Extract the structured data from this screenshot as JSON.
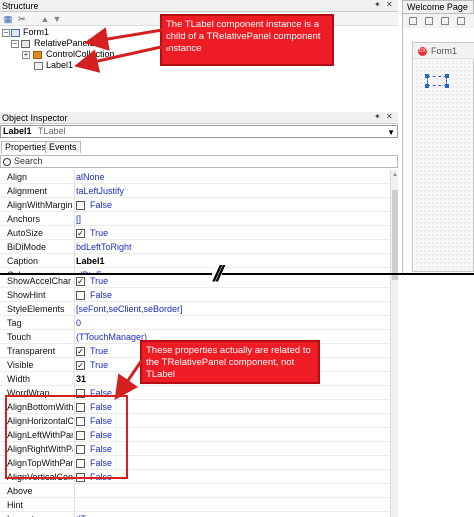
{
  "structure": {
    "title": "Structure",
    "tree": [
      {
        "label": "Form1"
      },
      {
        "label": "RelativePanel1"
      },
      {
        "label": "ControlCollection"
      },
      {
        "label": "Label1"
      }
    ]
  },
  "tabs_right": {
    "welcome": "Welcome Page",
    "form_caption": "Form1"
  },
  "inspector": {
    "title": "Object Inspector",
    "component": "Label1",
    "component_type": "TLabel",
    "tab_properties": "Properties",
    "tab_events": "Events",
    "search_placeholder": "Search",
    "props_top": [
      {
        "name": "Align",
        "value": "alNone"
      },
      {
        "name": "Alignment",
        "value": "taLeftJustify"
      },
      {
        "name": "AlignWithMargins",
        "value": "False",
        "check": true
      },
      {
        "name": "Anchors",
        "value": "[]"
      },
      {
        "name": "AutoSize",
        "value": "True",
        "check": true,
        "checked": true
      },
      {
        "name": "BiDiMode",
        "value": "bdLeftToRight"
      },
      {
        "name": "Caption",
        "value": "Label1",
        "bold": true
      },
      {
        "name": "Color",
        "value": "clBtnFace"
      }
    ],
    "props_bottom": [
      {
        "name": "ShowAccelChar",
        "value": "True",
        "check": true,
        "checked": true
      },
      {
        "name": "ShowHint",
        "value": "False",
        "check": true
      },
      {
        "name": "StyleElements",
        "value": "[seFont,seClient,seBorder]"
      },
      {
        "name": "Tag",
        "value": "0"
      },
      {
        "name": "Touch",
        "value": "(TTouchManager)"
      },
      {
        "name": "Transparent",
        "value": "True",
        "check": true,
        "checked": true
      },
      {
        "name": "Visible",
        "value": "True",
        "check": true,
        "checked": true
      },
      {
        "name": "Width",
        "value": "31",
        "bold": true
      },
      {
        "name": "WordWrap",
        "value": "False",
        "check": true
      },
      {
        "name": "AlignBottomWithPanel",
        "value": "False",
        "check": true
      },
      {
        "name": "AlignHorizontalCenterWithPanel",
        "value": "False",
        "check": true
      },
      {
        "name": "AlignLeftWithPanel",
        "value": "False",
        "check": true
      },
      {
        "name": "AlignRightWithPanel",
        "value": "False",
        "check": true
      },
      {
        "name": "AlignTopWithPanel",
        "value": "False",
        "check": true
      },
      {
        "name": "AlignVerticalCenterWithPanel",
        "value": "False",
        "check": true
      },
      {
        "name": "Above",
        "value": ""
      },
      {
        "name": "Hint",
        "value": ""
      },
      {
        "name": "Layout",
        "value": "tlTop"
      }
    ]
  },
  "annotations": {
    "top": "The TLabel component instance is a child of a TRelativePanel component instance",
    "bottom": "These properties actually are related to the TRelativePanel component, not TLabel",
    "break_mark": "//"
  },
  "colors": {
    "callout": "#ee1c24",
    "value_blue": "#1a2db8"
  }
}
